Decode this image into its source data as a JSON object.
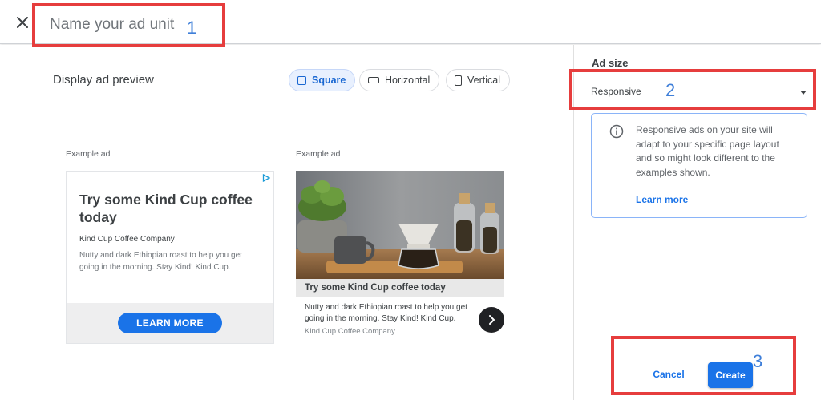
{
  "header": {
    "name_placeholder": "Name your ad unit"
  },
  "annotations": [
    "1",
    "2",
    "3"
  ],
  "preview": {
    "title": "Display ad preview",
    "chips": [
      {
        "label": "Square",
        "selected": true
      },
      {
        "label": "Horizontal",
        "selected": false
      },
      {
        "label": "Vertical",
        "selected": false
      }
    ],
    "example_label": "Example ad",
    "ad1": {
      "headline": "Try some Kind Cup coffee today",
      "advertiser": "Kind Cup Coffee Company",
      "description": "Nutty and dark Ethiopian roast to help you get going in the morning. Stay Kind! Kind Cup.",
      "cta": "LEARN MORE"
    },
    "ad2": {
      "headline": "Try some Kind Cup coffee today",
      "description": "Nutty and dark Ethiopian roast to help you get going in the morning. Stay Kind! Kind Cup.",
      "advertiser": "Kind Cup Coffee Company"
    }
  },
  "sidebar": {
    "ad_size_label": "Ad size",
    "selected_size": "Responsive",
    "info_text": "Responsive ads on your site will adapt to your specific page layout and so might look different to the examples shown.",
    "learn_more": "Learn more",
    "cancel": "Cancel",
    "create": "Create"
  },
  "colors": {
    "accent": "#1a73e8",
    "annotation_red": "#e63d3d",
    "annotation_blue": "#3f7fd9"
  },
  "icons": [
    "close-icon",
    "square-icon",
    "horizontal-icon",
    "vertical-icon",
    "adchoices-icon",
    "chevron-right-icon",
    "info-icon",
    "dropdown-arrow-icon"
  ]
}
